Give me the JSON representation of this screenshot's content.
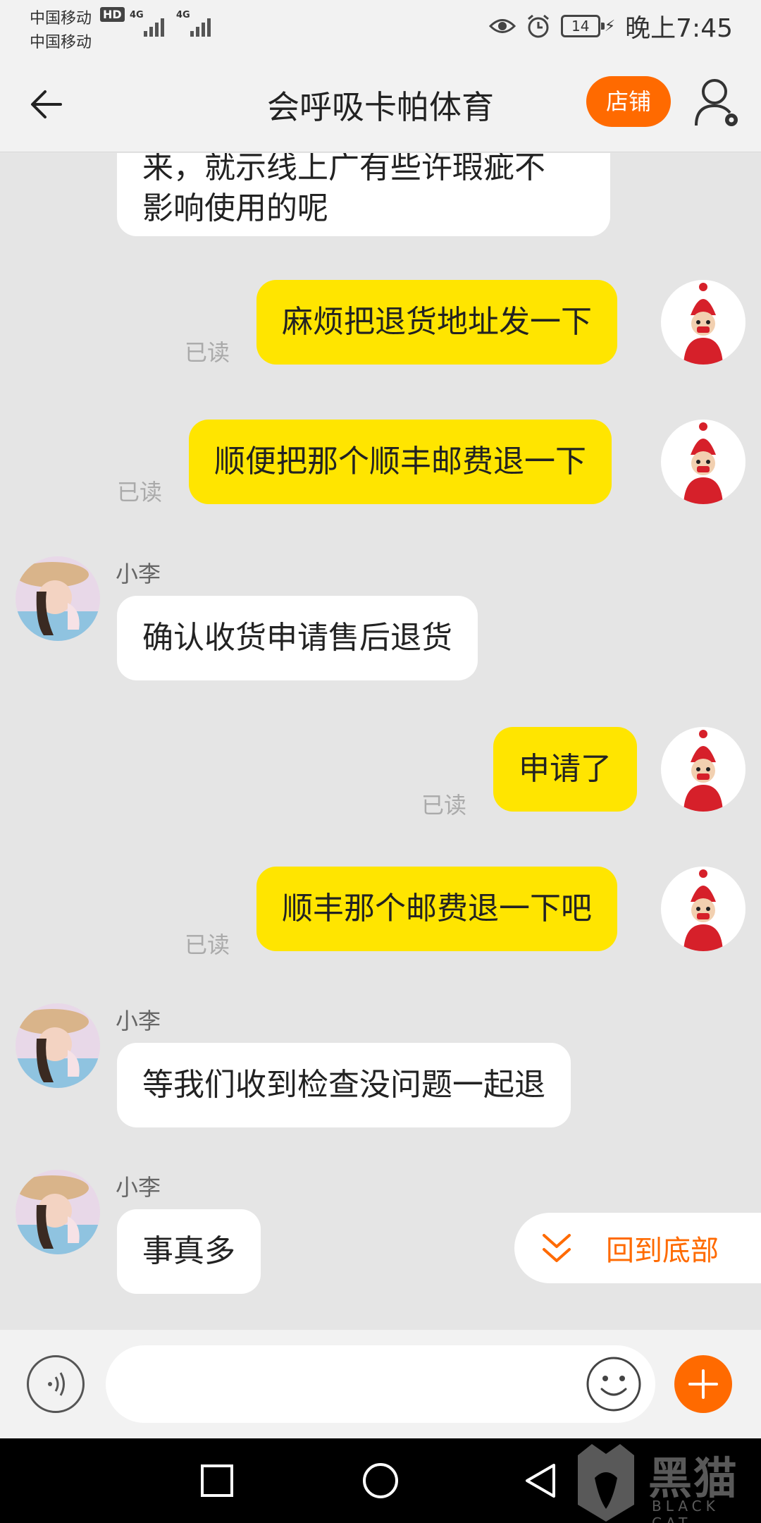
{
  "status_bar": {
    "carrier_1": "中国移动",
    "carrier_2": "中国移动",
    "hd_badge": "HD",
    "signal_1": "4G",
    "signal_2": "4G",
    "battery": "14",
    "time": "晚上7:45",
    "icons": [
      "eye-icon",
      "alarm-icon",
      "battery-icon",
      "charging-icon"
    ]
  },
  "navbar": {
    "title": "会呼吸卡帕体育",
    "shop_button": "店铺",
    "icons": [
      "back-arrow-icon",
      "user-settings-icon"
    ]
  },
  "messages": [
    {
      "side": "left",
      "text": "来，就示线上广有些许瑕疵不\n影响使用的呢",
      "partial": true
    },
    {
      "side": "right",
      "text": "麻烦把退货地址发一下",
      "status": "已读"
    },
    {
      "side": "right",
      "text": "顺便把那个顺丰邮费退一下",
      "status": "已读"
    },
    {
      "side": "left",
      "sender": "小李",
      "text": "确认收货申请售后退货"
    },
    {
      "side": "right",
      "text": "申请了",
      "status": "已读"
    },
    {
      "side": "right",
      "text": "顺丰那个邮费退一下吧",
      "status": "已读"
    },
    {
      "side": "left",
      "sender": "小李",
      "text": "等我们收到检查没问题一起退"
    },
    {
      "side": "left",
      "sender": "小李",
      "text": "事真多"
    }
  ],
  "back_to_bottom": {
    "label": "回到底部",
    "icon": "double-chevron-down-icon"
  },
  "input_bar": {
    "placeholder": "",
    "icons": [
      "voice-icon",
      "emoji-icon",
      "plus-icon"
    ]
  },
  "system_nav": {
    "icons": [
      "recent-apps-icon",
      "home-icon",
      "back-icon"
    ]
  },
  "watermark": {
    "text": "黑猫",
    "sub": "BLACK CAT"
  },
  "colors": {
    "accent": "#ff6a00",
    "bubble_self": "#ffe500",
    "bubble_other": "#ffffff",
    "chat_bg": "#e5e5e5"
  }
}
